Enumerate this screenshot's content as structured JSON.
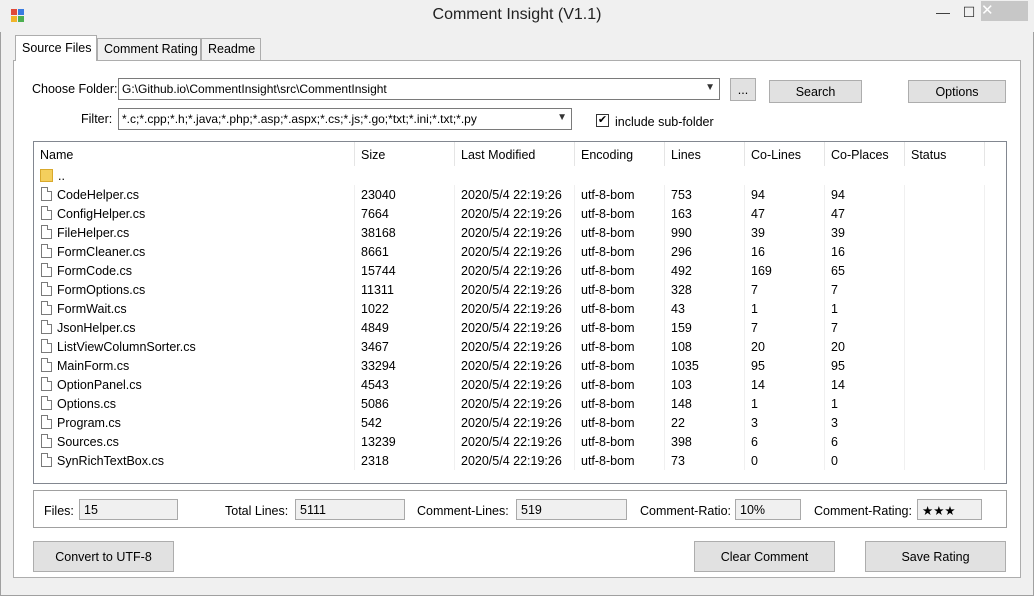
{
  "window": {
    "title": "Comment Insight (V1.1)",
    "minimize": "—",
    "maximize": "☐",
    "close": "✕"
  },
  "tabs": [
    "Source Files",
    "Comment Rating",
    "Readme"
  ],
  "folder": {
    "label": "Choose Folder:",
    "value": "G:\\Github.io\\CommentInsight\\src\\CommentInsight",
    "browse_label": "...",
    "search_label": "Search",
    "options_label": "Options"
  },
  "filter": {
    "label": "Filter:",
    "value": "*.c;*.cpp;*.h;*.java;*.php;*.asp;*.aspx;*.cs;*.js;*.go;*txt;*.ini;*.txt;*.py",
    "include_sub_label": "include sub-folder",
    "include_sub_checked": true
  },
  "columns": [
    "Name",
    "Size",
    "Last Modified",
    "Encoding",
    "Lines",
    "Co-Lines",
    "Co-Places",
    "Status"
  ],
  "parent_row": "..",
  "files": [
    [
      "CodeHelper.cs",
      "23040",
      "2020/5/4 22:19:26",
      "utf-8-bom",
      "753",
      "94",
      "94",
      ""
    ],
    [
      "ConfigHelper.cs",
      "7664",
      "2020/5/4 22:19:26",
      "utf-8-bom",
      "163",
      "47",
      "47",
      ""
    ],
    [
      "FileHelper.cs",
      "38168",
      "2020/5/4 22:19:26",
      "utf-8-bom",
      "990",
      "39",
      "39",
      ""
    ],
    [
      "FormCleaner.cs",
      "8661",
      "2020/5/4 22:19:26",
      "utf-8-bom",
      "296",
      "16",
      "16",
      ""
    ],
    [
      "FormCode.cs",
      "15744",
      "2020/5/4 22:19:26",
      "utf-8-bom",
      "492",
      "169",
      "65",
      ""
    ],
    [
      "FormOptions.cs",
      "11311",
      "2020/5/4 22:19:26",
      "utf-8-bom",
      "328",
      "7",
      "7",
      ""
    ],
    [
      "FormWait.cs",
      "1022",
      "2020/5/4 22:19:26",
      "utf-8-bom",
      "43",
      "1",
      "1",
      ""
    ],
    [
      "JsonHelper.cs",
      "4849",
      "2020/5/4 22:19:26",
      "utf-8-bom",
      "159",
      "7",
      "7",
      ""
    ],
    [
      "ListViewColumnSorter.cs",
      "3467",
      "2020/5/4 22:19:26",
      "utf-8-bom",
      "108",
      "20",
      "20",
      ""
    ],
    [
      "MainForm.cs",
      "33294",
      "2020/5/4 22:19:26",
      "utf-8-bom",
      "1035",
      "95",
      "95",
      ""
    ],
    [
      "OptionPanel.cs",
      "4543",
      "2020/5/4 22:19:26",
      "utf-8-bom",
      "103",
      "14",
      "14",
      ""
    ],
    [
      "Options.cs",
      "5086",
      "2020/5/4 22:19:26",
      "utf-8-bom",
      "148",
      "1",
      "1",
      ""
    ],
    [
      "Program.cs",
      "542",
      "2020/5/4 22:19:26",
      "utf-8-bom",
      "22",
      "3",
      "3",
      ""
    ],
    [
      "Sources.cs",
      "13239",
      "2020/5/4 22:19:26",
      "utf-8-bom",
      "398",
      "6",
      "6",
      ""
    ],
    [
      "SynRichTextBox.cs",
      "2318",
      "2020/5/4 22:19:26",
      "utf-8-bom",
      "73",
      "0",
      "0",
      ""
    ]
  ],
  "stats": {
    "files_label": "Files:",
    "files_value": "15",
    "total_lines_label": "Total Lines:",
    "total_lines_value": "5111",
    "comment_lines_label": "Comment-Lines:",
    "comment_lines_value": "519",
    "comment_ratio_label": "Comment-Ratio:",
    "comment_ratio_value": "10%",
    "comment_rating_label": "Comment-Rating:",
    "comment_rating_value": "★★★"
  },
  "actions": {
    "convert_label": "Convert to UTF-8",
    "clear_label": "Clear Comment",
    "save_label": "Save Rating"
  },
  "colors": {
    "accent_folder": "#f4cf5d",
    "window_bg": "#f0f0f0",
    "button_bg": "#e1e1e1"
  }
}
